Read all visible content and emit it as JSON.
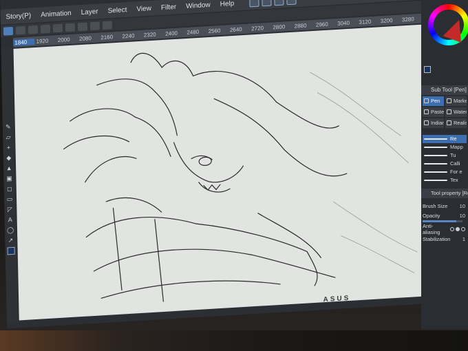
{
  "app": {
    "menu": [
      "Story(P)",
      "Animation",
      "Layer",
      "Select",
      "View",
      "Filter",
      "Window",
      "Help"
    ]
  },
  "ruler": {
    "ticks": [
      "1840",
      "1920",
      "2000",
      "2080",
      "2160",
      "2240",
      "2320",
      "2400",
      "2480",
      "2560",
      "2640",
      "2720",
      "2800",
      "2880",
      "2960",
      "3040",
      "3120",
      "3200",
      "3280"
    ],
    "highlight_index": 0
  },
  "sub_tool": {
    "header": "Sub Tool [Pen]",
    "items": [
      {
        "label": "Pen",
        "active": true
      },
      {
        "label": "Marker",
        "active": false
      },
      {
        "label": "Pastel",
        "active": false
      },
      {
        "label": "Water",
        "active": false
      },
      {
        "label": "Indian",
        "active": false
      },
      {
        "label": "Realistic",
        "active": false
      }
    ],
    "brushes": [
      {
        "label": "Re",
        "active": true
      },
      {
        "label": "Mapp",
        "active": false
      },
      {
        "label": "Tu",
        "active": false
      },
      {
        "label": "Calli",
        "active": false
      },
      {
        "label": "For e",
        "active": false
      },
      {
        "label": "Tex",
        "active": false
      }
    ]
  },
  "tool_property": {
    "header": "Tool property [Real G",
    "brush_size": {
      "label": "Brush Size",
      "value": "10"
    },
    "opacity": {
      "label": "Opacity",
      "value": "10"
    },
    "opacity_level": 0.85,
    "anti_aliasing": {
      "label": "Anti-aliasing"
    },
    "stabilization": {
      "label": "Stabilization",
      "value": "1"
    }
  },
  "colors": {
    "main_color": "#15355e",
    "accent": "#3d6fb0"
  },
  "bezel": {
    "brand": "ASUS"
  }
}
